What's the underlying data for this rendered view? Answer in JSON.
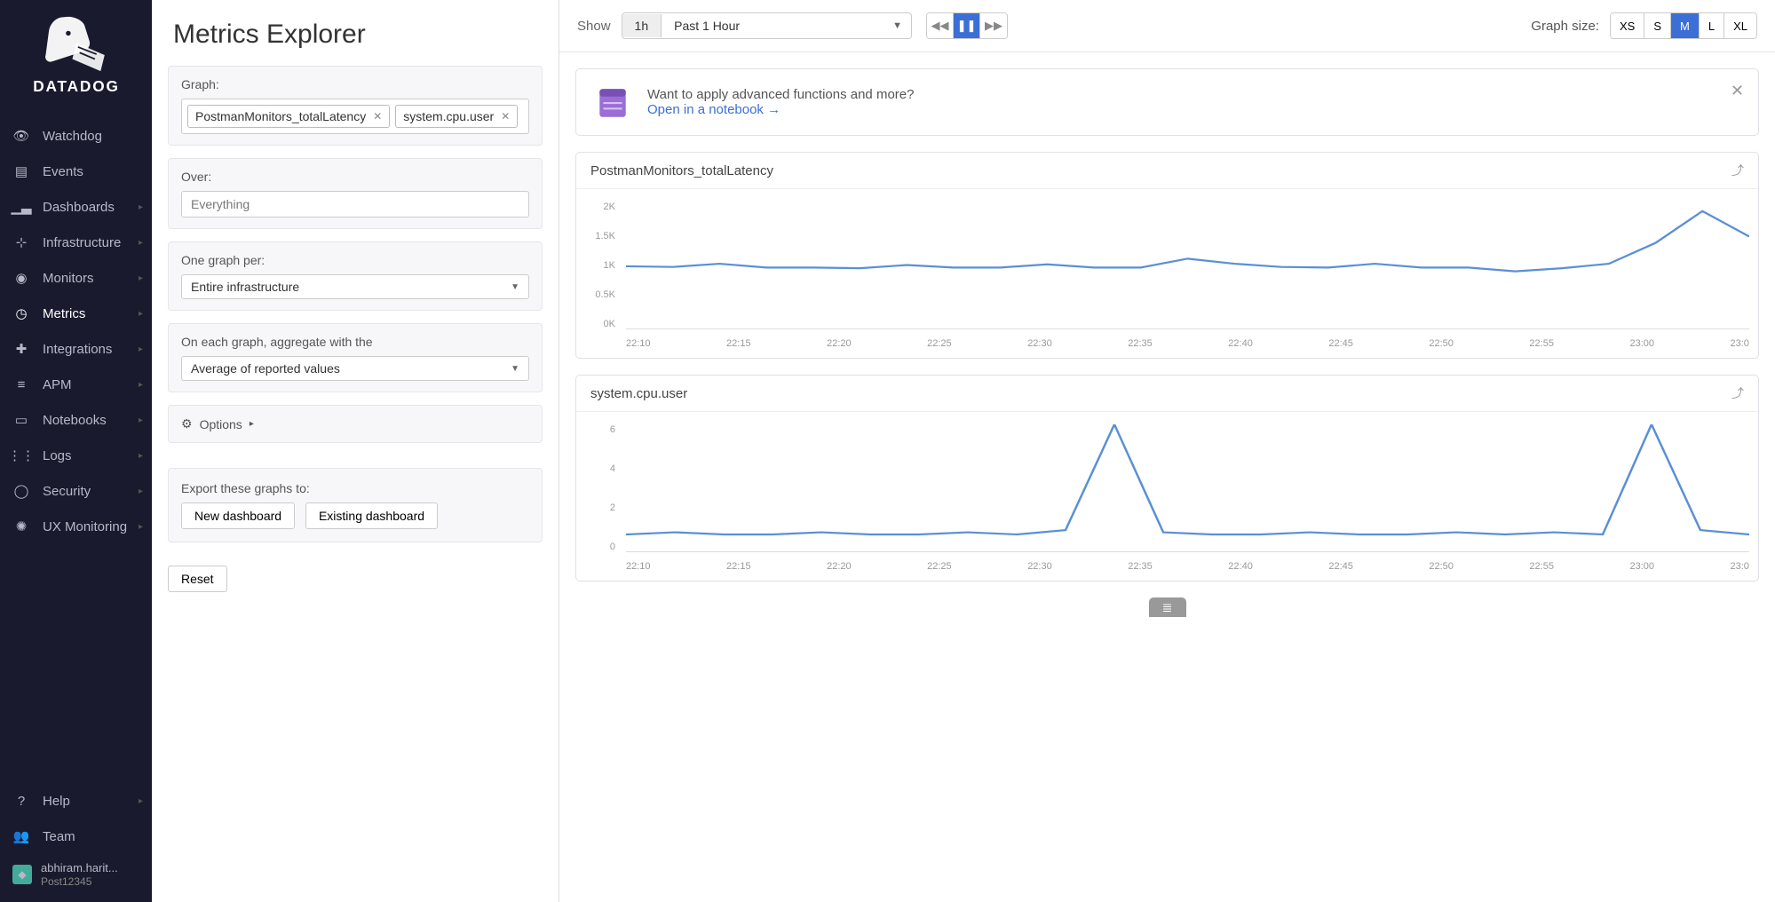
{
  "brand": "DATADOG",
  "sidebar": {
    "items": [
      {
        "label": "Watchdog"
      },
      {
        "label": "Events"
      },
      {
        "label": "Dashboards"
      },
      {
        "label": "Infrastructure"
      },
      {
        "label": "Monitors"
      },
      {
        "label": "Metrics"
      },
      {
        "label": "Integrations"
      },
      {
        "label": "APM"
      },
      {
        "label": "Notebooks"
      },
      {
        "label": "Logs"
      },
      {
        "label": "Security"
      },
      {
        "label": "UX Monitoring"
      }
    ],
    "footer": [
      {
        "label": "Help"
      },
      {
        "label": "Team"
      }
    ],
    "user": {
      "name": "abhiram.harit...",
      "org": "Post12345"
    }
  },
  "page_title": "Metrics Explorer",
  "config": {
    "graph_label": "Graph:",
    "graph_tags": [
      "PostmanMonitors_totalLatency",
      "system.cpu.user"
    ],
    "over_label": "Over:",
    "over_placeholder": "Everything",
    "one_graph_label": "One graph per:",
    "one_graph_value": "Entire infrastructure",
    "aggregate_label": "On each graph, aggregate with the",
    "aggregate_value": "Average of reported values",
    "options_label": "Options",
    "export_label": "Export these graphs to:",
    "export_new": "New dashboard",
    "export_existing": "Existing dashboard",
    "reset": "Reset"
  },
  "topbar": {
    "show_label": "Show",
    "time_short": "1h",
    "time_long": "Past 1 Hour",
    "size_label": "Graph size:",
    "sizes": [
      "XS",
      "S",
      "M",
      "L",
      "XL"
    ],
    "size_selected": "M"
  },
  "notice": {
    "line1": "Want to apply advanced functions and more?",
    "link": "Open in a notebook →"
  },
  "graphs": [
    {
      "title": "PostmanMonitors_totalLatency"
    },
    {
      "title": "system.cpu.user"
    }
  ],
  "chart_data": [
    {
      "type": "line",
      "title": "PostmanMonitors_totalLatency",
      "ylabel": "",
      "ylim": [
        0,
        2000
      ],
      "y_ticks": [
        "2K",
        "1.5K",
        "1K",
        "0.5K",
        "0K"
      ],
      "x_ticks": [
        "22:10",
        "22:15",
        "22:20",
        "22:25",
        "22:30",
        "22:35",
        "22:40",
        "22:45",
        "22:50",
        "22:55",
        "23:00",
        "23:0"
      ],
      "x": [
        "22:07",
        "22:10",
        "22:12",
        "22:13",
        "22:15",
        "22:17",
        "22:20",
        "22:23",
        "22:25",
        "22:27",
        "22:30",
        "22:33",
        "22:35",
        "22:38",
        "22:40",
        "22:43",
        "22:45",
        "22:48",
        "22:50",
        "22:52",
        "22:55",
        "22:57",
        "23:00",
        "23:03",
        "23:05"
      ],
      "values": [
        980,
        970,
        1020,
        960,
        960,
        950,
        1000,
        960,
        960,
        1010,
        960,
        960,
        1100,
        1020,
        970,
        960,
        1020,
        960,
        960,
        900,
        950,
        1020,
        1350,
        1850,
        1450
      ]
    },
    {
      "type": "line",
      "title": "system.cpu.user",
      "ylabel": "",
      "ylim": [
        0,
        6
      ],
      "y_ticks": [
        "6",
        "4",
        "2",
        "0"
      ],
      "x_ticks": [
        "22:10",
        "22:15",
        "22:20",
        "22:25",
        "22:30",
        "22:35",
        "22:40",
        "22:45",
        "22:50",
        "22:55",
        "23:00",
        "23:0"
      ],
      "x": [
        "22:07",
        "22:10",
        "22:13",
        "22:16",
        "22:19",
        "22:22",
        "22:25",
        "22:28",
        "22:31",
        "22:33",
        "22:34",
        "22:35",
        "22:38",
        "22:41",
        "22:44",
        "22:47",
        "22:50",
        "22:53",
        "22:56",
        "22:59",
        "23:01",
        "23:02",
        "23:03",
        "23:05"
      ],
      "values": [
        0.8,
        0.9,
        0.8,
        0.8,
        0.9,
        0.8,
        0.8,
        0.9,
        0.8,
        1.0,
        6.0,
        0.9,
        0.8,
        0.8,
        0.9,
        0.8,
        0.8,
        0.9,
        0.8,
        0.9,
        0.8,
        6.0,
        1.0,
        0.8
      ]
    }
  ]
}
